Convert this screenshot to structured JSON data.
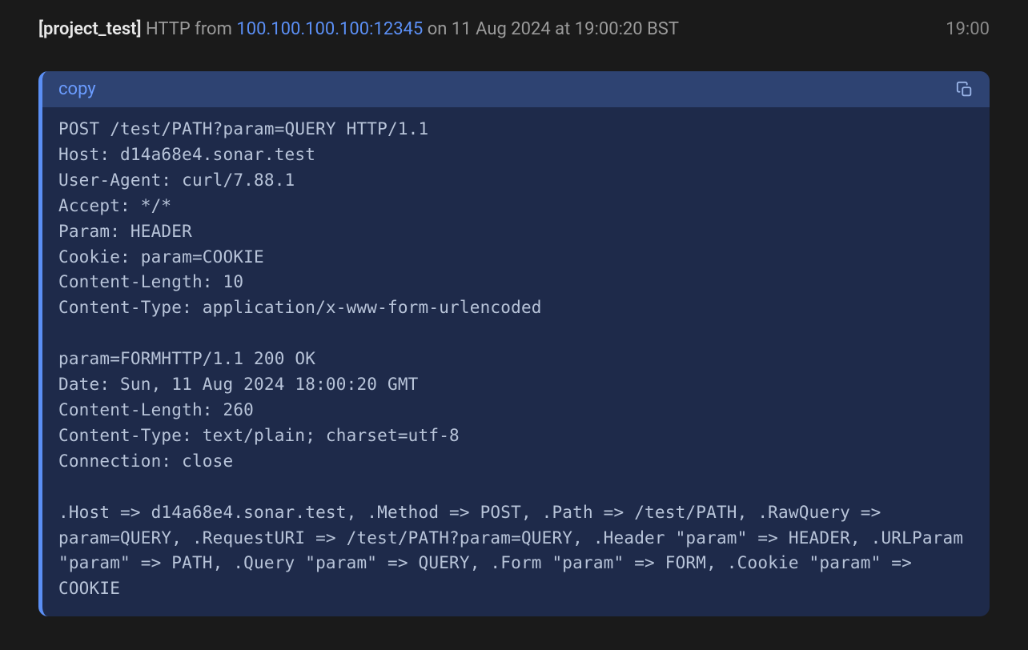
{
  "header": {
    "project_tag": "[project_test]",
    "prefix": " HTTP from ",
    "ip": "100.100.100.100:12345",
    "suffix": " on 11 Aug 2024 at 19:00:20 BST",
    "short_time": "19:00"
  },
  "code": {
    "copy_label": "copy",
    "body": "POST /test/PATH?param=QUERY HTTP/1.1\nHost: d14a68e4.sonar.test\nUser-Agent: curl/7.88.1\nAccept: */*\nParam: HEADER\nCookie: param=COOKIE\nContent-Length: 10\nContent-Type: application/x-www-form-urlencoded\n\nparam=FORMHTTP/1.1 200 OK\nDate: Sun, 11 Aug 2024 18:00:20 GMT\nContent-Length: 260\nContent-Type: text/plain; charset=utf-8\nConnection: close\n\n.Host => d14a68e4.sonar.test, .Method => POST, .Path => /test/PATH, .RawQuery => param=QUERY, .RequestURI => /test/PATH?param=QUERY, .Header \"param\" => HEADER, .URLParam \"param\" => PATH, .Query \"param\" => QUERY, .Form \"param\" => FORM, .Cookie \"param\" => COOKIE"
  }
}
